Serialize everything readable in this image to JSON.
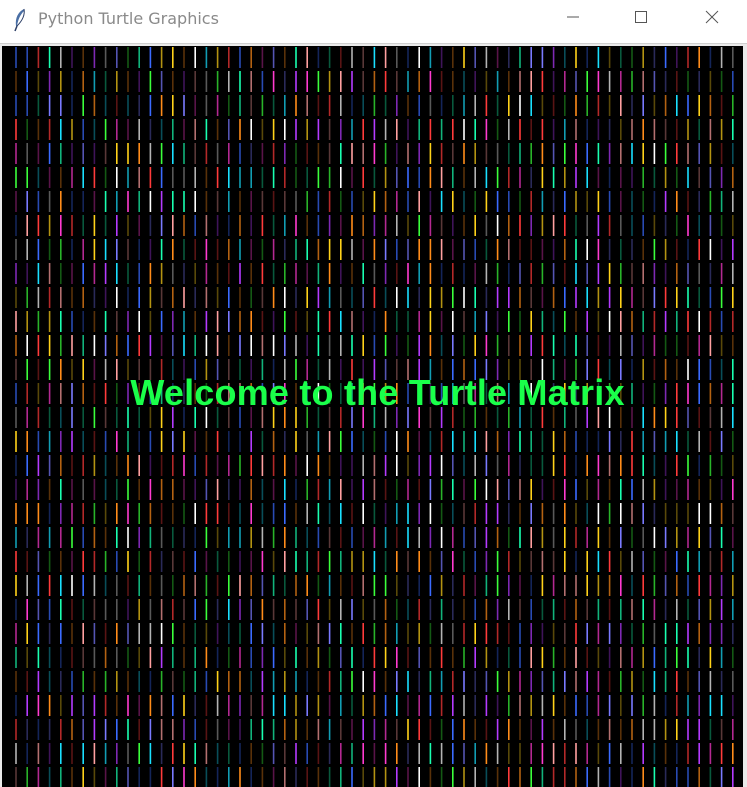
{
  "window": {
    "title": "Python Turtle Graphics",
    "icon": "feather-icon",
    "controls": {
      "minimize_icon": "minimize-icon",
      "maximize_icon": "maximize-icon",
      "close_icon": "close-icon"
    }
  },
  "canvas": {
    "background": "#000000",
    "message": "Welcome to the Turtle Matrix",
    "message_color": "#1aff4a",
    "rain_palette": [
      "#ff3b3b",
      "#ff8c1a",
      "#ffd21a",
      "#3bff3b",
      "#1ae0ff",
      "#3b6bff",
      "#b43bff",
      "#ff3bd0",
      "#ffffff",
      "#1affb0",
      "#7a7aff",
      "#ffa0a0"
    ]
  }
}
